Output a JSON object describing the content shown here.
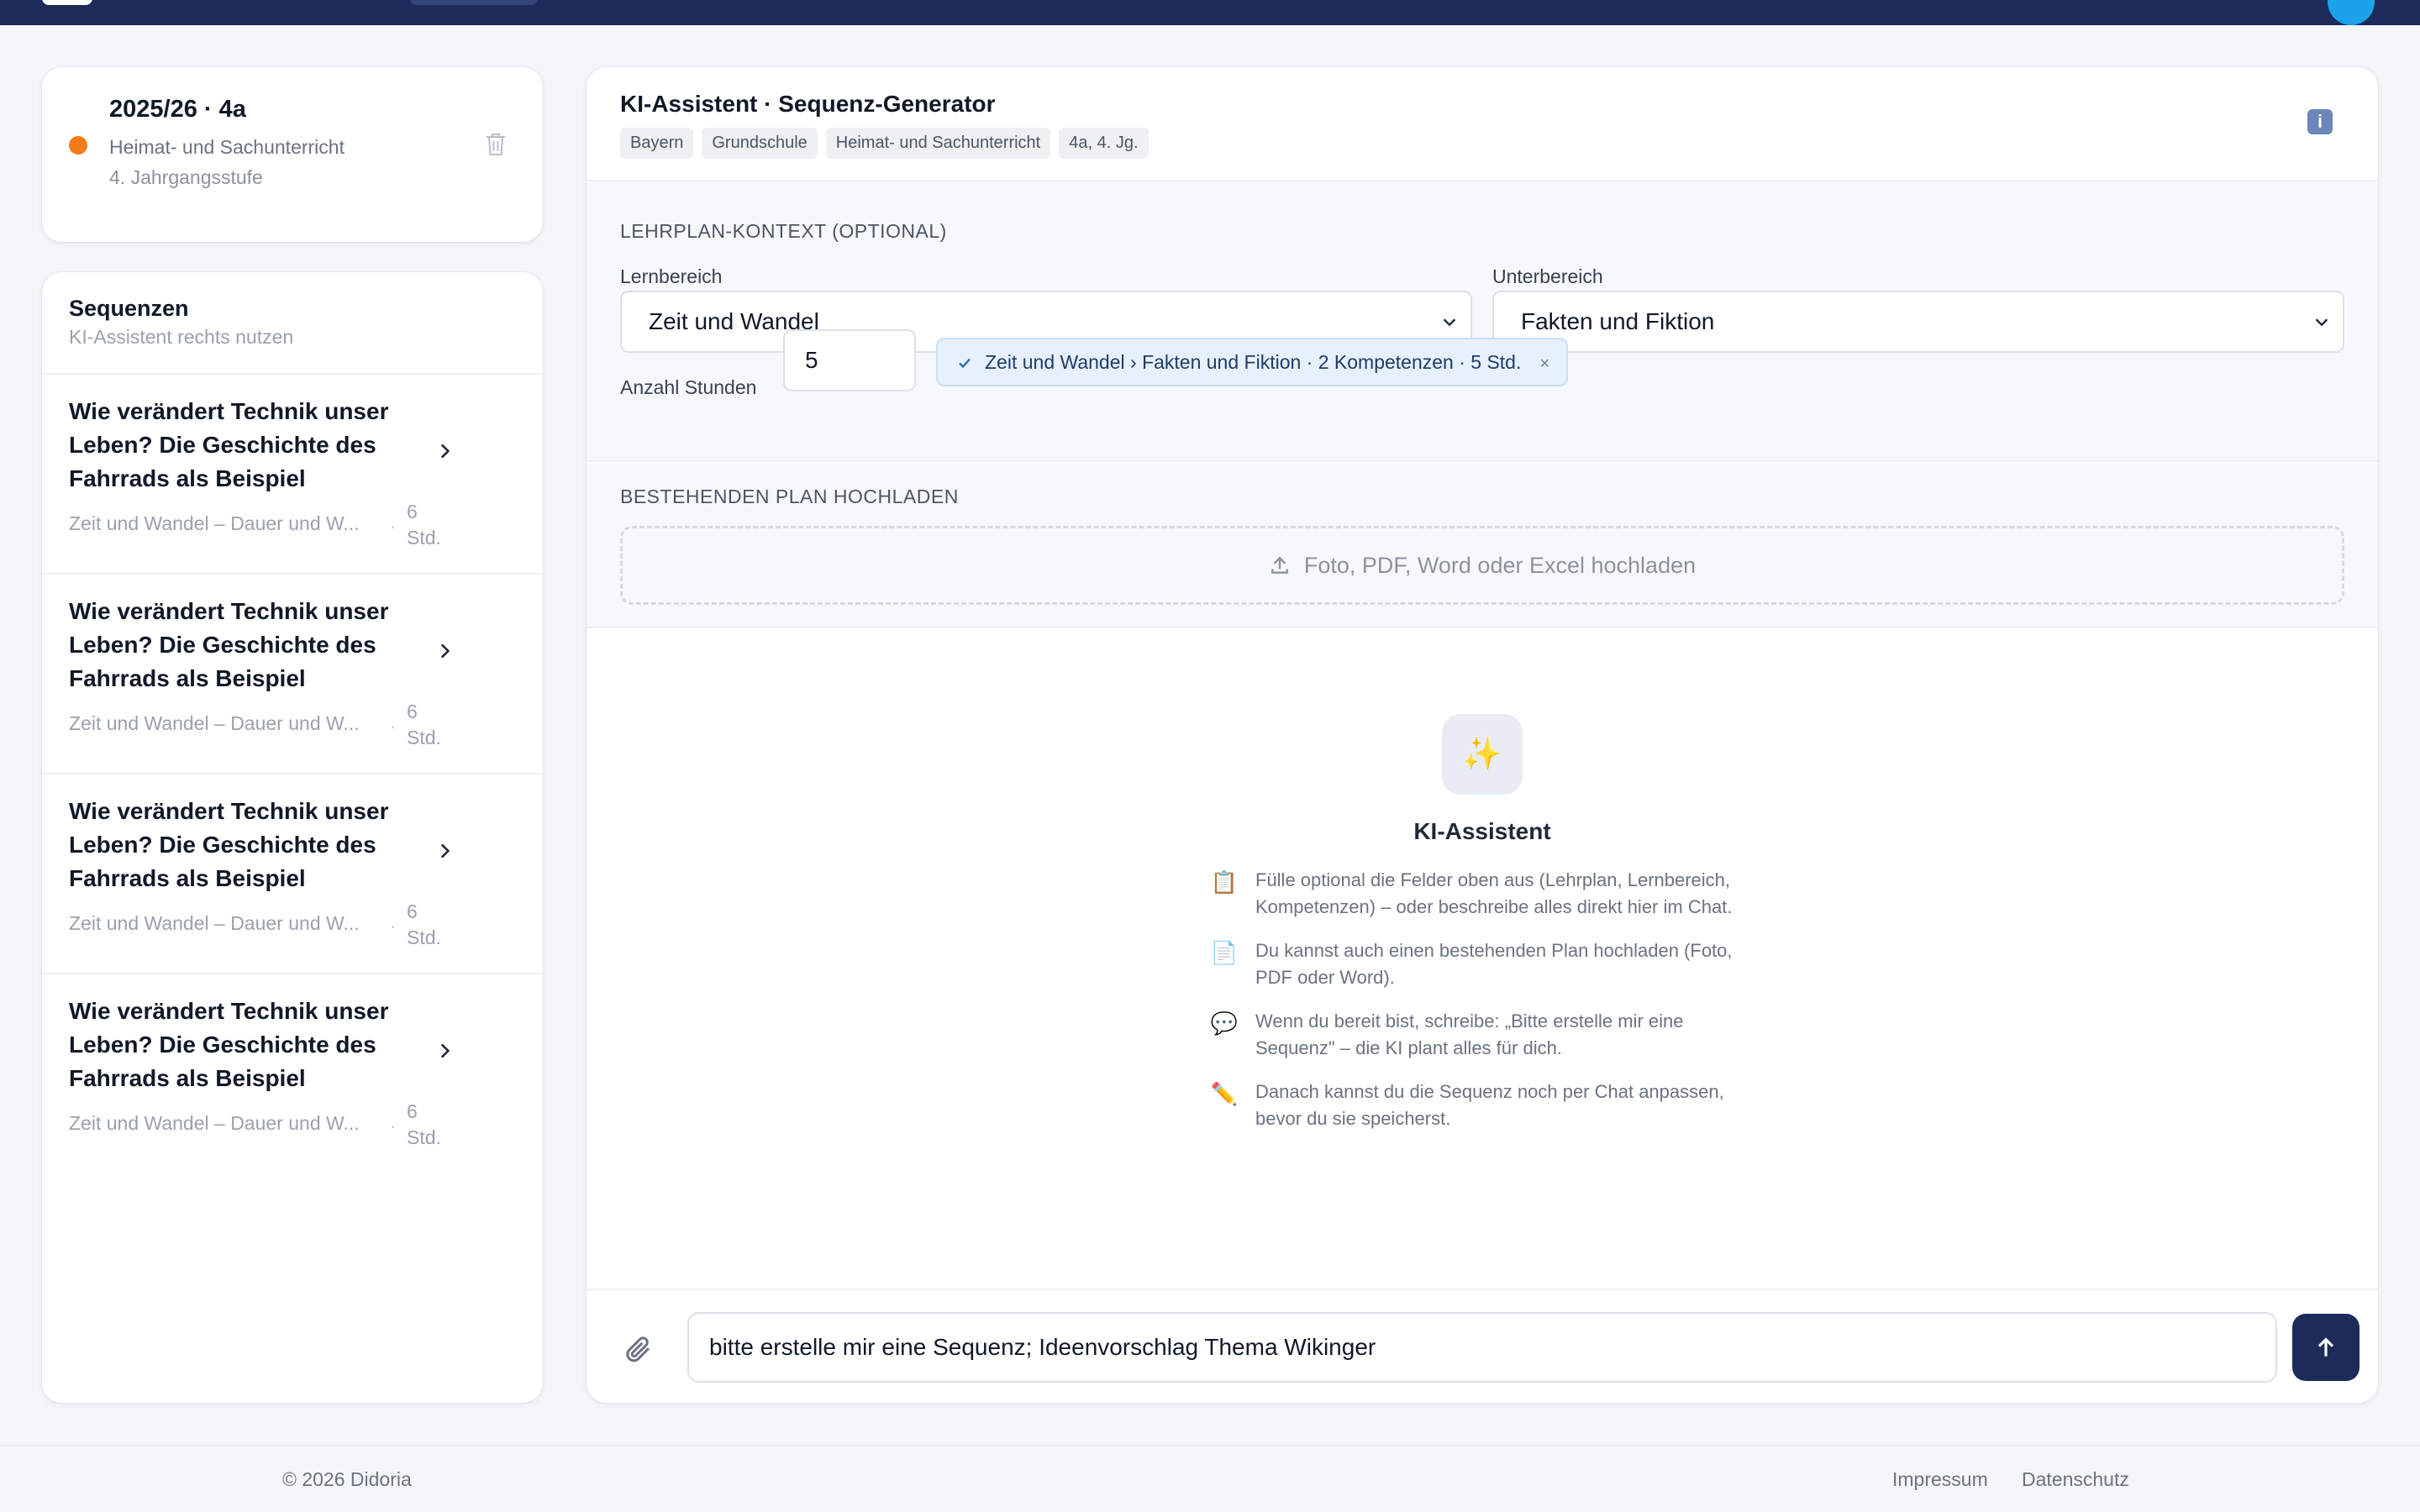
{
  "class_card": {
    "title": "2025/26 · 4a",
    "subject": "Heimat- und Sachunterricht",
    "grade": "4. Jahrgangsstufe",
    "dot_color": "#f47a1a"
  },
  "sequences": {
    "heading": "Sequenzen",
    "hint": "KI-Assistent rechts nutzen",
    "items": [
      {
        "title": "Wie verändert Technik unser Leben? Die Geschichte des Fahrrads als Beispiel",
        "meta": "Zeit und Wandel – Dauer und W...",
        "hours": "6 Std."
      },
      {
        "title": "Wie verändert Technik unser Leben? Die Geschichte des Fahrrads als Beispiel",
        "meta": "Zeit und Wandel – Dauer und W...",
        "hours": "6 Std."
      },
      {
        "title": "Wie verändert Technik unser Leben? Die Geschichte des Fahrrads als Beispiel",
        "meta": "Zeit und Wandel – Dauer und W...",
        "hours": "6 Std."
      },
      {
        "title": "Wie verändert Technik unser Leben? Die Geschichte des Fahrrads als Beispiel",
        "meta": "Zeit und Wandel – Dauer und W...",
        "hours": "6 Std."
      }
    ]
  },
  "main": {
    "title": "KI-Assistent · Sequenz-Generator",
    "chips": [
      "Bayern",
      "Grundschule",
      "Heimat- und Sachunterricht",
      "4a, 4. Jg."
    ],
    "info_icon": "info-icon",
    "context": {
      "section_label": "LEHRPLAN-KONTEXT (OPTIONAL)",
      "lernbereich_label": "Lernbereich",
      "lernbereich_value": "Zeit und Wandel",
      "unterbereich_label": "Unterbereich",
      "unterbereich_value": "Fakten und Fiktion",
      "hours_label": "Anzahl Stunden",
      "hours_value": "5",
      "summary_chip": "Zeit und Wandel › Fakten und Fiktion · 2 Kompetenzen · 5 Std.",
      "chip_close": "×"
    },
    "upload": {
      "section_label": "BESTEHENDEN PLAN HOCHLADEN",
      "dropzone_text": "Foto, PDF, Word oder Excel hochladen"
    },
    "assistant": {
      "badge_icon": "✨",
      "title": "KI-Assistent",
      "tips": [
        {
          "icon": "📋",
          "text": "Fülle optional die Felder oben aus (Lehrplan, Lernbereich, Kompetenzen) – oder beschreibe alles direkt hier im Chat."
        },
        {
          "icon": "📄",
          "text": "Du kannst auch einen bestehenden Plan hochladen (Foto, PDF oder Word)."
        },
        {
          "icon": "💬",
          "text": "Wenn du bereit bist, schreibe: „Bitte erstelle mir eine Sequenz\" – die KI plant alles für dich."
        },
        {
          "icon": "✏️",
          "text": "Danach kannst du die Sequenz noch per Chat anpassen, bevor du sie speicherst."
        }
      ]
    },
    "composer": {
      "input_value": "bitte erstelle mir eine Sequenz; Ideenvorschlag Thema Wikinger"
    }
  },
  "footer": {
    "copyright": "© 2026 Didoria",
    "impressum": "Impressum",
    "datenschutz": "Datenschutz"
  },
  "colors": {
    "nav": "#1c2b5a",
    "accent_orange": "#f47a1a",
    "send_button": "#1c2b5a",
    "chip_bg": "#e6f1fd"
  }
}
